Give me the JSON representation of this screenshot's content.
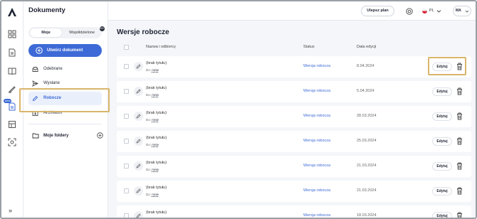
{
  "app": {
    "title": "Dokumenty"
  },
  "sidebar": {
    "tabs": {
      "mine": "Moje",
      "shared": "Współdzielone",
      "shared_badge": "99+"
    },
    "create_label": "Utwórz dokument",
    "items": [
      {
        "label": "Odebrane",
        "icon": "inbox-icon"
      },
      {
        "label": "Wysłane",
        "icon": "send-icon"
      },
      {
        "label": "Robocze",
        "icon": "pencil-icon",
        "active": true
      },
      {
        "label": "Archiwum",
        "icon": "archive-icon"
      }
    ],
    "folders_label": "Moje foldery"
  },
  "rail": {
    "new_badge": "new"
  },
  "topbar": {
    "upgrade_label": "Ulepsz plan",
    "language": "PL",
    "avatar_initials": "MA"
  },
  "main": {
    "title": "Wersje robocze",
    "columns": {
      "name": "Nazwa i odbiorcy",
      "status": "Status",
      "date": "Data edycji"
    },
    "to_prefix": "Do:",
    "edit_label": "Edytuj",
    "rows": [
      {
        "name": "(brak tytułu)",
        "recipient": "mnie",
        "status": "Wersja robocza",
        "date": "8.04.2024"
      },
      {
        "name": "(brak tytułu)",
        "recipient": "mnie",
        "status": "Wersja robocza",
        "date": "5.04.2024"
      },
      {
        "name": "(brak tytułu)",
        "recipient": "mnie",
        "status": "Wersja robocza",
        "date": "28.03.2024"
      },
      {
        "name": "(brak tytułu)",
        "recipient": "mnie",
        "status": "Wersja robocza",
        "date": "25.03.2024"
      },
      {
        "name": "(brak tytułu)",
        "recipient": "mnie",
        "status": "Wersja robocza",
        "date": "21.03.2024"
      },
      {
        "name": "(brak tytułu)",
        "recipient": "mnie",
        "status": "Wersja robocza",
        "date": "21.03.2024"
      },
      {
        "name": "(brak tytułu)",
        "recipient": "mnie",
        "status": "Wersja robocza",
        "date": "18.03.2024"
      }
    ]
  },
  "colors": {
    "accent": "#3d6ad6",
    "highlight": "#d9b56a"
  }
}
